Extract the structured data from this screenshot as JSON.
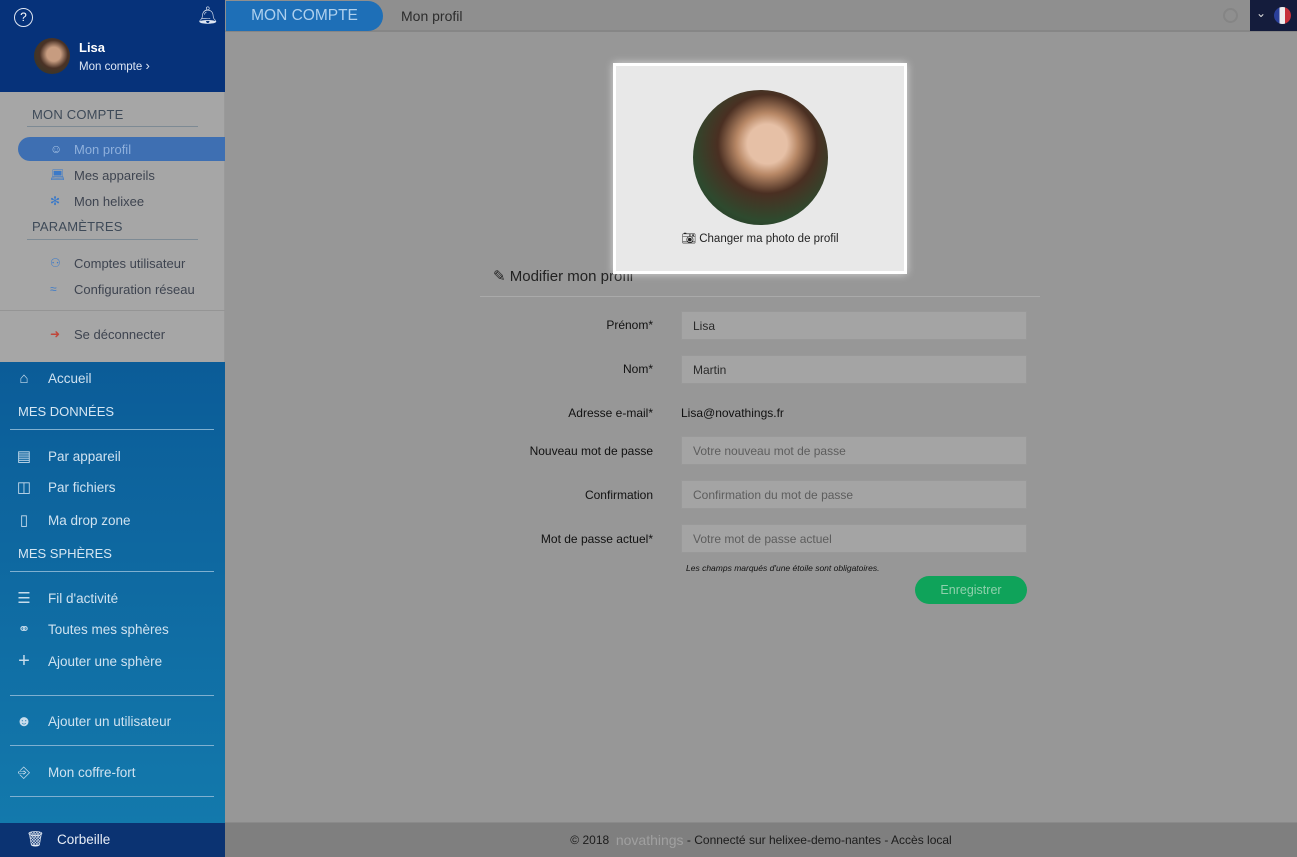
{
  "header": {
    "tab": "MON COMPTE",
    "breadcrumb": "Mon profil"
  },
  "user": {
    "name": "Lisa",
    "link": "Mon compte"
  },
  "account_menu": {
    "section1": "MON COMPTE",
    "items1": [
      {
        "label": "Mon profil",
        "icon": "user-icon",
        "active": true
      },
      {
        "label": "Mes appareils",
        "icon": "laptop-icon"
      },
      {
        "label": "Mon helixee",
        "icon": "helixee-icon"
      }
    ],
    "section2": "PARAMÈTRES",
    "items2": [
      {
        "label": "Comptes utilisateur",
        "icon": "users-icon"
      },
      {
        "label": "Configuration réseau",
        "icon": "wifi-icon"
      }
    ],
    "logout": "Se déconnecter"
  },
  "nav": {
    "home": "Accueil",
    "section_data": "MES DONNÉES",
    "data_items": [
      "Par appareil",
      "Par fichiers",
      "Ma drop zone"
    ],
    "section_spheres": "MES SPHÈRES",
    "sphere_items": [
      "Fil d'activité",
      "Toutes mes sphères",
      "Ajouter une sphère"
    ],
    "add_user": "Ajouter un utilisateur",
    "vault": "Mon coffre-fort",
    "trash": "Corbeille"
  },
  "profile": {
    "change_photo": "Changer ma photo de profil",
    "form_title": "Modifier mon profil",
    "fields": [
      {
        "label": "Prénom*",
        "value": "Lisa",
        "placeholder": ""
      },
      {
        "label": "Nom*",
        "value": "Martin",
        "placeholder": ""
      },
      {
        "label": "Adresse e-mail*",
        "value": "Lisa@novathings.fr",
        "readonly": true
      },
      {
        "label": "Nouveau mot de passe",
        "value": "",
        "placeholder": "Votre nouveau mot de passe"
      },
      {
        "label": "Confirmation",
        "value": "",
        "placeholder": "Confirmation du mot de passe"
      },
      {
        "label": "Mot de passe actuel*",
        "value": "",
        "placeholder": "Votre mot de passe actuel"
      }
    ],
    "required_note": "Les champs marqués d'une étoile sont obligatoires.",
    "save": "Enregistrer"
  },
  "footer": {
    "copyright": "© 2018",
    "brand": "novathings",
    "status": "- Connecté sur helixee-demo-nantes - Accès local"
  },
  "colors": {
    "accent": "#1e6fb7",
    "save": "#0fa35a",
    "sidebar_top": "#06327a"
  }
}
